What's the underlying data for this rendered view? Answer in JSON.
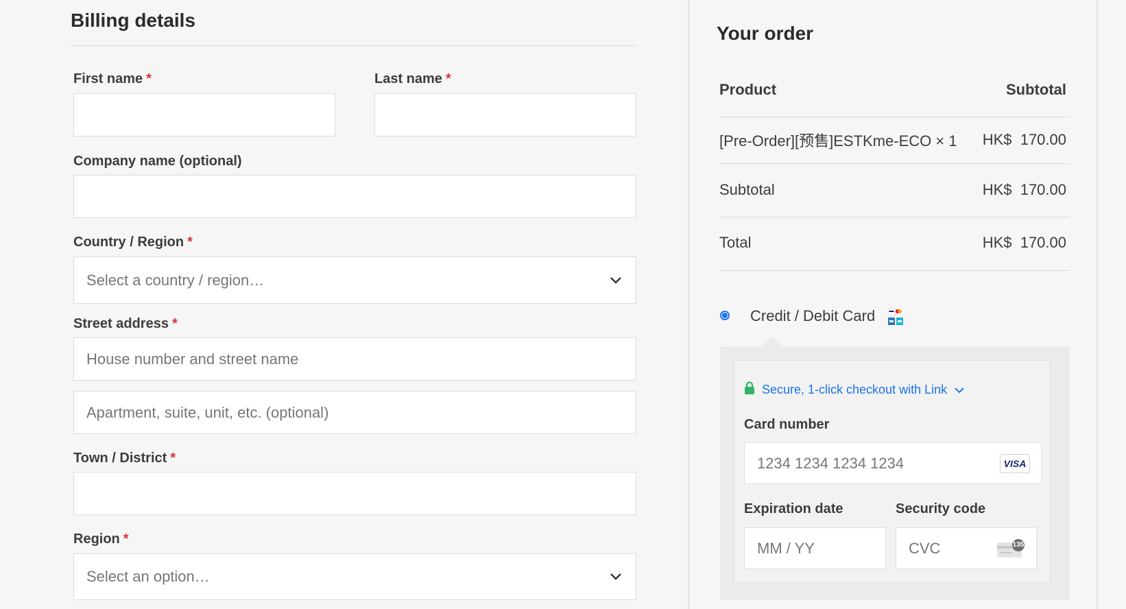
{
  "billing": {
    "title": "Billing details",
    "required_mark": "*",
    "first_name": {
      "label": "First name",
      "value": ""
    },
    "last_name": {
      "label": "Last name",
      "value": ""
    },
    "company": {
      "label": "Company name (optional)",
      "value": ""
    },
    "country": {
      "label": "Country / Region",
      "placeholder": "Select a country / region…"
    },
    "street": {
      "label": "Street address",
      "line1_placeholder": "House number and street name",
      "line2_placeholder": "Apartment, suite, unit, etc. (optional)"
    },
    "town": {
      "label": "Town / District",
      "value": ""
    },
    "region": {
      "label": "Region",
      "placeholder": "Select an option…"
    }
  },
  "order": {
    "title": "Your order",
    "header": {
      "product": "Product",
      "subtotal": "Subtotal"
    },
    "items": [
      {
        "name": "[Pre-Order][预售]ESTKme-ECO × 1",
        "price": "HK$  170.00"
      }
    ],
    "subtotal": {
      "label": "Subtotal",
      "value": "HK$  170.00"
    },
    "total": {
      "label": "Total",
      "value": "HK$  170.00"
    }
  },
  "payment": {
    "method_label": "Credit / Debit Card",
    "selected": true,
    "link_text": "Secure, 1-click checkout with Link",
    "card_number": {
      "label": "Card number",
      "placeholder": "1234 1234 1234 1234",
      "brand": "VISA"
    },
    "expiry": {
      "label": "Expiration date",
      "placeholder": "MM / YY"
    },
    "cvc": {
      "label": "Security code",
      "placeholder": "CVC",
      "icon_text": "135"
    }
  },
  "colors": {
    "required": "#d63638",
    "link": "#1a73e8",
    "lock": "#30b566"
  },
  "icons": [
    "chevron-down-icon",
    "lock-icon",
    "visa-icon",
    "card-brands-icon",
    "cvc-card-icon"
  ]
}
